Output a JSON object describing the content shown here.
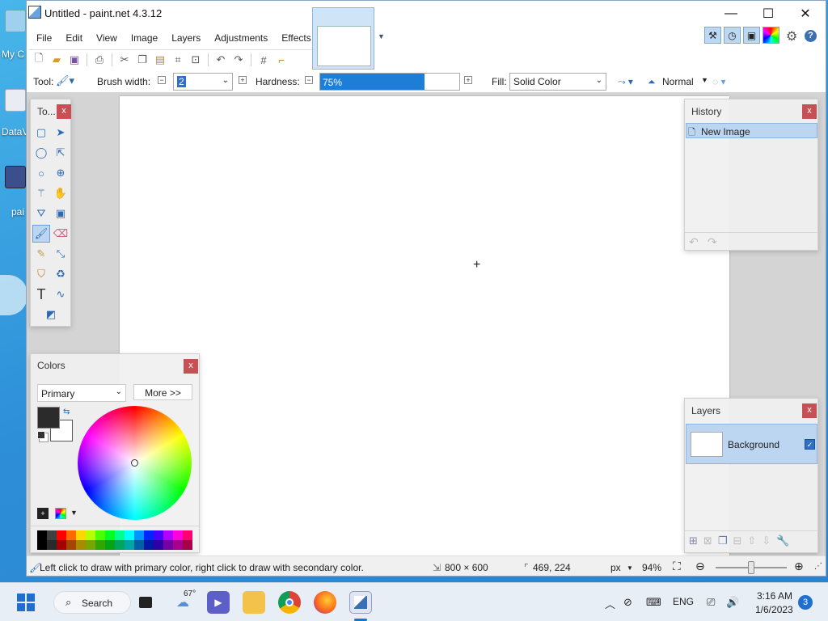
{
  "desktop": {
    "icons": [
      {
        "label": "My C"
      },
      {
        "label": "DataV"
      },
      {
        "label": "pai"
      }
    ]
  },
  "window": {
    "title": "Untitled - paint.net 4.3.12",
    "minimize": "—",
    "maximize": "☐",
    "close": "✕"
  },
  "menu": {
    "items": [
      "File",
      "Edit",
      "View",
      "Image",
      "Layers",
      "Adjustments",
      "Effects"
    ]
  },
  "toolbar": {
    "tool_label": "Tool:",
    "brush_width_label": "Brush width:",
    "brush_width_value": "2",
    "hardness_label": "Hardness:",
    "hardness_value": "75%",
    "hardness_fraction": 0.75,
    "fill_label": "Fill:",
    "fill_value": "Solid Color",
    "blend_value": "Normal"
  },
  "tools_panel": {
    "title": "To...",
    "close": "x"
  },
  "history_panel": {
    "title": "History",
    "close": "x",
    "items": [
      "New Image"
    ]
  },
  "colors_panel": {
    "title": "Colors",
    "close": "x",
    "mode": "Primary",
    "more_button": "More >>",
    "primary_color": "#2b2b2b",
    "secondary_color": "#ffffff",
    "palette": [
      "#000000",
      "#404040",
      "#ff0000",
      "#ff6a00",
      "#ffd800",
      "#b6ff00",
      "#4cff00",
      "#00ff21",
      "#00ff90",
      "#00ffff",
      "#0094ff",
      "#0026ff",
      "#4800ff",
      "#b200ff",
      "#ff00dc",
      "#ff006e"
    ]
  },
  "layers_panel": {
    "title": "Layers",
    "close": "x",
    "layers": [
      {
        "name": "Background",
        "visible": true
      }
    ]
  },
  "status": {
    "hint": "Left click to draw with primary color, right click to draw with secondary color.",
    "image_size": "800 × 600",
    "cursor_pos": "469, 224",
    "units": "px",
    "zoom": "94%"
  },
  "taskbar": {
    "search": "Search",
    "weather": "67°",
    "language": "ENG",
    "time": "3:16 AM",
    "date": "1/6/2023",
    "notifications": "3"
  }
}
